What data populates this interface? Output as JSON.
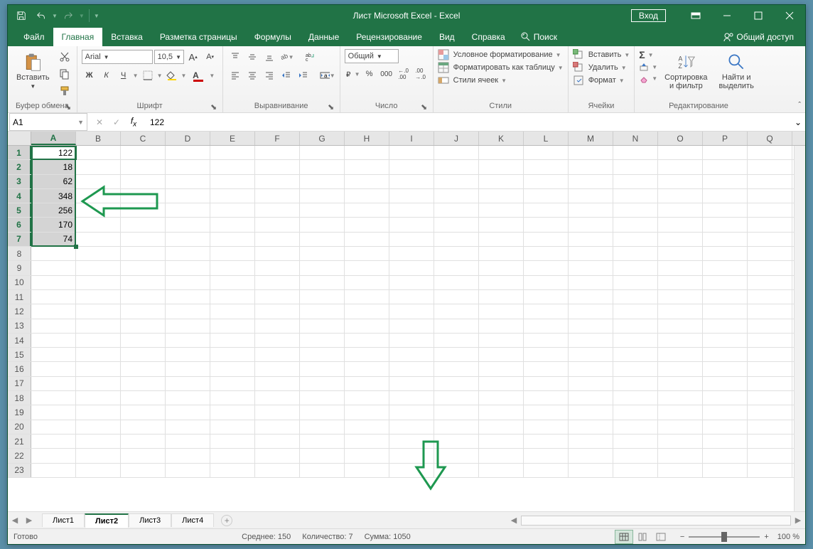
{
  "titlebar": {
    "title": "Лист Microsoft Excel  -  Excel",
    "login": "Вход"
  },
  "menu": {
    "file": "Файл",
    "home": "Главная",
    "insert": "Вставка",
    "page_layout": "Разметка страницы",
    "formulas": "Формулы",
    "data": "Данные",
    "review": "Рецензирование",
    "view": "Вид",
    "help": "Справка",
    "search": "Поиск",
    "share": "Общий доступ"
  },
  "ribbon": {
    "clipboard": {
      "paste": "Вставить",
      "label": "Буфер обмена"
    },
    "font": {
      "name": "Arial",
      "size": "10,5",
      "label": "Шрифт",
      "bold": "Ж",
      "italic": "К",
      "underline": "Ч"
    },
    "alignment": {
      "label": "Выравнивание"
    },
    "number": {
      "format": "Общий",
      "label": "Число"
    },
    "styles": {
      "cond": "Условное форматирование",
      "table": "Форматировать как таблицу",
      "cell": "Стили ячеек",
      "label": "Стили"
    },
    "cells": {
      "insert": "Вставить",
      "delete": "Удалить",
      "format": "Формат",
      "label": "Ячейки"
    },
    "editing": {
      "sort": "Сортировка\nи фильтр",
      "find": "Найти и\nвыделить",
      "label": "Редактирование"
    }
  },
  "formula": {
    "name_box": "A1",
    "value": "122"
  },
  "columns": [
    "A",
    "B",
    "C",
    "D",
    "E",
    "F",
    "G",
    "H",
    "I",
    "J",
    "K",
    "L",
    "M",
    "N",
    "O",
    "P",
    "Q"
  ],
  "rows_data": [
    {
      "n": 1,
      "A": "122"
    },
    {
      "n": 2,
      "A": "18"
    },
    {
      "n": 3,
      "A": "62"
    },
    {
      "n": 4,
      "A": "348"
    },
    {
      "n": 5,
      "A": "256"
    },
    {
      "n": 6,
      "A": "170"
    },
    {
      "n": 7,
      "A": "74"
    }
  ],
  "num_rows": 23,
  "sheets": {
    "s1": "Лист1",
    "s2": "Лист2",
    "s3": "Лист3",
    "s4": "Лист4"
  },
  "status": {
    "ready": "Готово",
    "avg": "Среднее: 150",
    "count": "Количество: 7",
    "sum": "Сумма: 1050",
    "zoom": "100 %"
  }
}
